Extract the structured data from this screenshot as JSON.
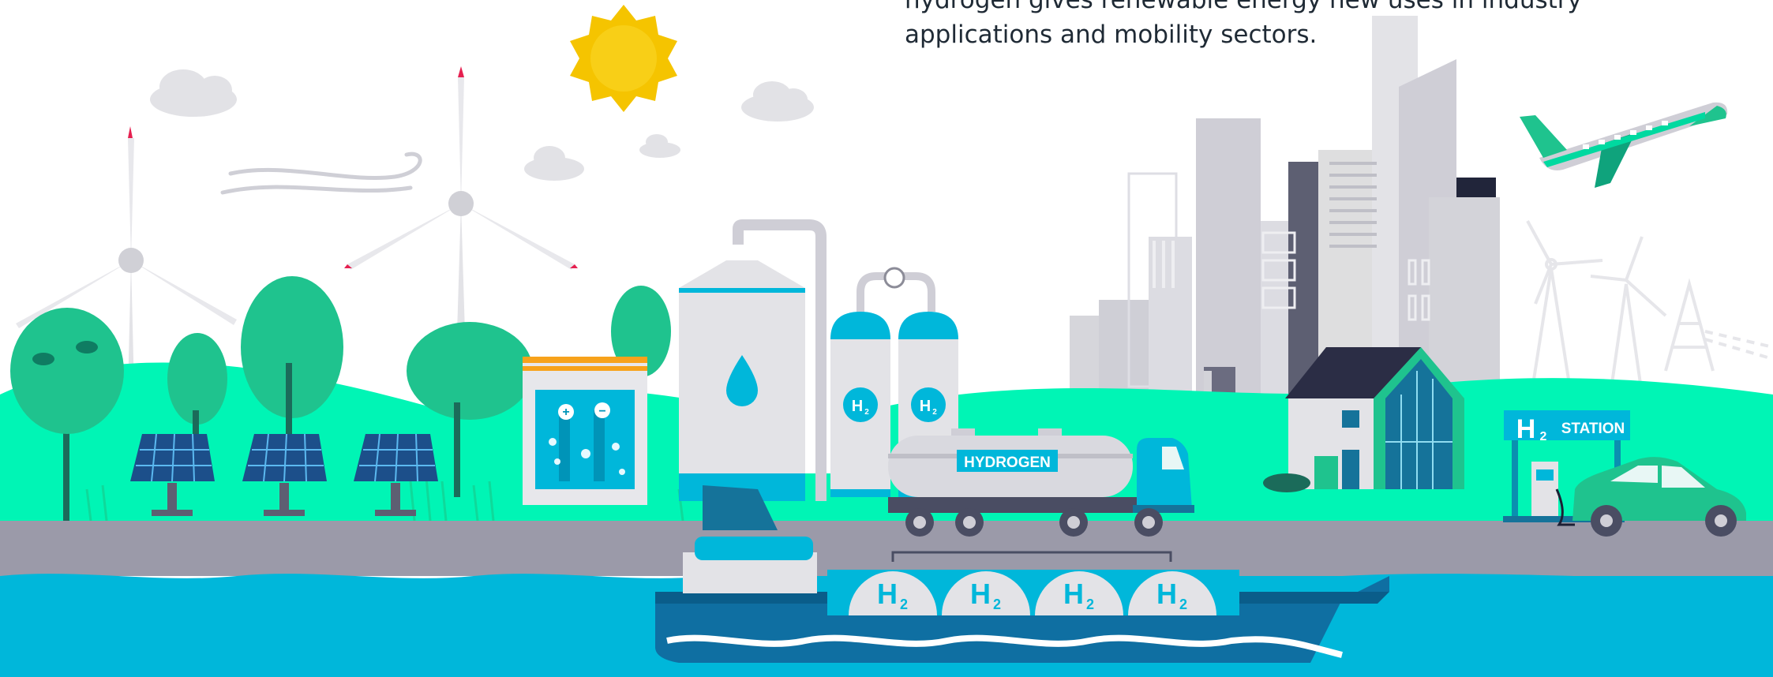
{
  "caption": {
    "line1": "hydrogen gives renewable energy new uses in industry",
    "line2": "applications and mobility sectors."
  },
  "labels": {
    "tank_left": "H",
    "tank_right": "H",
    "tank_sub": "2",
    "truck_label": "HYDROGEN",
    "ship_tank": "H",
    "ship_tank_sub": "2",
    "station_h": "H",
    "station_sub": "2",
    "station_label": "STATION"
  },
  "colors": {
    "teal": "#00d9a0",
    "teal_dark": "#0fa37c",
    "cyan": "#00b3d7",
    "grass": "#00f5b5",
    "road": "#9b9aa9",
    "water": "#00b7da",
    "building_gray": "#cfced6",
    "sun": "#f5c400"
  },
  "icons": [
    "sun-icon",
    "cloud-icon",
    "wind-icon",
    "water-drop-icon",
    "plus-icon",
    "minus-icon",
    "gauge-icon"
  ]
}
